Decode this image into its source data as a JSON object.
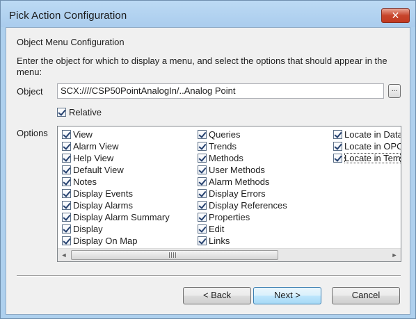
{
  "window": {
    "title": "Pick Action Configuration",
    "close_glyph": "✕"
  },
  "section_title": "Object Menu Configuration",
  "instructions": "Enter the object for which to display a menu, and select the options that should appear in the menu:",
  "object": {
    "label": "Object",
    "value": "SCX:////CSP50PointAnalogIn/..Analog Point",
    "browse_label": "..."
  },
  "relative": {
    "label": "Relative",
    "checked": true
  },
  "options": {
    "label": "Options",
    "columns": [
      [
        "View",
        "Alarm View",
        "Help View",
        "Default View",
        "Notes",
        "Display Events",
        "Display Alarms",
        "Display Alarm Summary",
        "Display",
        "Display On Map"
      ],
      [
        "Queries",
        "Trends",
        "Methods",
        "User Methods",
        "Alarm Methods",
        "Display Errors",
        "Display References",
        "Properties",
        "Edit",
        "Links"
      ],
      [
        "Locate in Data",
        "Locate in OPC",
        "Locate in Tem"
      ]
    ],
    "focused_item": "Locate in Tem"
  },
  "scrollbar": {
    "left_glyph": "◄",
    "right_glyph": "►"
  },
  "buttons": {
    "back": "< Back",
    "next": "Next >",
    "cancel": "Cancel"
  },
  "icons": {
    "checkmark": "checkmark-icon",
    "close": "close-icon",
    "grip": "grip-icon"
  },
  "colors": {
    "title_bar": "#aed0ee",
    "close_button": "#c7442b",
    "default_button_border": "#3c7fb1"
  }
}
